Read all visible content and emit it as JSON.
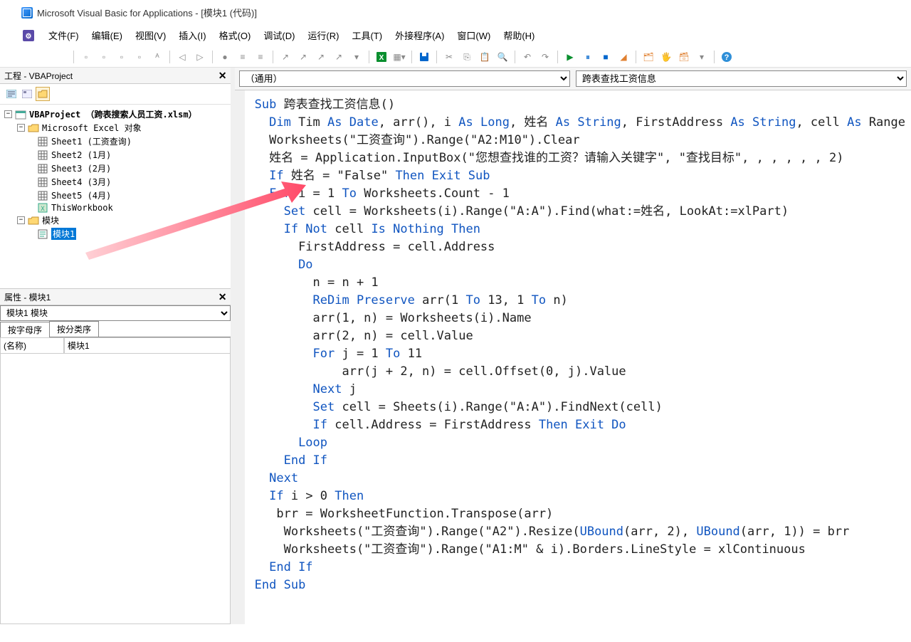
{
  "title": "Microsoft Visual Basic for Applications - [模块1 (代码)]",
  "menu": {
    "file": "文件(F)",
    "edit": "编辑(E)",
    "view": "视图(V)",
    "insert": "插入(I)",
    "format": "格式(O)",
    "debug": "调试(D)",
    "run": "运行(R)",
    "tools": "工具(T)",
    "addins": "外接程序(A)",
    "window": "窗口(W)",
    "help": "帮助(H)"
  },
  "project_panel": {
    "title": "工程 - VBAProject",
    "root": "VBAProject （跨表搜索人员工资.xlsm）",
    "excel_objects": "Microsoft Excel 对象",
    "sheets": [
      "Sheet1 (工资查询)",
      "Sheet2 (1月)",
      "Sheet3 (2月)",
      "Sheet4 (3月)",
      "Sheet5 (4月)"
    ],
    "thisworkbook": "ThisWorkbook",
    "modules_folder": "模块",
    "module1": "模块1"
  },
  "props_panel": {
    "title": "属性 - 模块1",
    "combo": "模块1 模块",
    "tab_alpha": "按字母序",
    "tab_cat": "按分类序",
    "name_label": "(名称)",
    "name_value": "模块1"
  },
  "code_dropdowns": {
    "left": "（通用）",
    "right": "跨表查找工资信息"
  },
  "code": {
    "l1_a": "Sub",
    "l1_b": " 跨表查找工资信息()",
    "l2_a": "  Dim",
    "l2_b": " Tim ",
    "l2_c": "As Date",
    "l2_d": ", arr(), i ",
    "l2_e": "As Long",
    "l2_f": ", 姓名 ",
    "l2_g": "As String",
    "l2_h": ", FirstAddress ",
    "l2_i": "As String",
    "l2_j": ", cell ",
    "l2_k": "As",
    "l2_l": " Range",
    "l3": "  Worksheets(\"工资查询\").Range(\"A2:M10\").Clear",
    "l4": "  姓名 = Application.InputBox(\"您想查找谁的工资？请输入关键字\", \"查找目标\", , , , , , 2)",
    "l5_a": "  If",
    "l5_b": " 姓名 = \"False\" ",
    "l5_c": "Then Exit Sub",
    "l6_a": "  For",
    "l6_b": " i = 1 ",
    "l6_c": "To",
    "l6_d": " Worksheets.Count - 1",
    "l7_a": "    Set",
    "l7_b": " cell = Worksheets(i).Range(\"A:A\").Find(what:=姓名, LookAt:=xlPart)",
    "l8_a": "    If Not",
    "l8_b": " cell ",
    "l8_c": "Is Nothing Then",
    "l9": "      FirstAddress = cell.Address",
    "l10": "      Do",
    "l11": "        n = n + 1",
    "l12_a": "        ReDim Preserve",
    "l12_b": " arr(1 ",
    "l12_c": "To",
    "l12_d": " 13, 1 ",
    "l12_e": "To",
    "l12_f": " n)",
    "l13": "        arr(1, n) = Worksheets(i).Name",
    "l14": "        arr(2, n) = cell.Value",
    "l15_a": "        For",
    "l15_b": " j = 1 ",
    "l15_c": "To",
    "l15_d": " 11",
    "l16": "            arr(j + 2, n) = cell.Offset(0, j).Value",
    "l17_a": "        Next",
    "l17_b": " j",
    "l18_a": "        Set",
    "l18_b": " cell = Sheets(i).Range(\"A:A\").FindNext(cell)",
    "l19_a": "        If",
    "l19_b": " cell.Address = FirstAddress ",
    "l19_c": "Then Exit Do",
    "l20": "      Loop",
    "l21": "    End If",
    "l22": "  Next",
    "l23_a": "  If",
    "l23_b": " i > 0 ",
    "l23_c": "Then",
    "l24": "   brr = WorksheetFunction.Transpose(arr)",
    "l25_a": "    Worksheets(\"工资查询\").Range(\"A2\").Resize(",
    "l25_b": "UBound",
    "l25_c": "(arr, 2), ",
    "l25_d": "UBound",
    "l25_e": "(arr, 1)) = brr",
    "l26": "    Worksheets(\"工资查询\").Range(\"A1:M\" & i).Borders.LineStyle = xlContinuous",
    "l27": "  End If",
    "l28": "End Sub"
  }
}
